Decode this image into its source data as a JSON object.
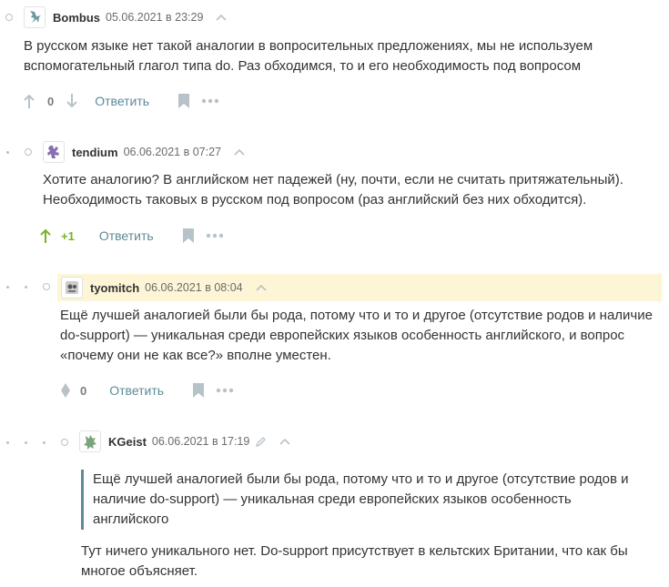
{
  "comments": [
    {
      "user": "Bombus",
      "date": "05.06.2021 в 23:29",
      "text": "В русском языке нет такой аналогии в вопросительных предложениях, мы не используем вспомогательный глагол типа do. Раз обходимся, то и его необходимость под вопросом",
      "score": "0",
      "reply": "Ответить"
    },
    {
      "user": "tendium",
      "date": "06.06.2021 в 07:27",
      "text": "Хотите аналогию? В английском нет падежей (ну, почти, если не считать притяжательный). Необходимость таковых в русском под вопросом (раз английский без них обходится).",
      "score": "+1",
      "reply": "Ответить"
    },
    {
      "user": "tyomitch",
      "date": "06.06.2021 в 08:04",
      "text": "Ещё лучшей аналогией были бы рода, потому что и то и другое (отсутствие родов и наличие do-support) — уникальная среди европейских языков особенность английского, и вопрос «почему они не как все?» вполне уместен.",
      "score": "0",
      "reply": "Ответить"
    },
    {
      "user": "KGeist",
      "date": "06.06.2021 в 17:19",
      "quote": "Ещё лучшей аналогией были бы рода, потому что и то и другое (отсутствие родов и наличие do-support) — уникальная среди европейских языков особенность английского",
      "text": "Тут ничего уникального нет. Do-support присутствует в кельтских Британии, что как бы многое объясняет."
    }
  ],
  "colors": {
    "link": "#5e8a98",
    "positive": "#7ab02d",
    "highlight": "#fdf5d6",
    "quote_border": "#5e8a98",
    "thread": "#b8c2c9"
  },
  "icons": [
    "avatar-identicon",
    "chevron-up-icon",
    "arrow-up-icon",
    "arrow-down-icon",
    "bookmark-icon",
    "more-icon",
    "pencil-icon",
    "diamond-vote-icon"
  ]
}
